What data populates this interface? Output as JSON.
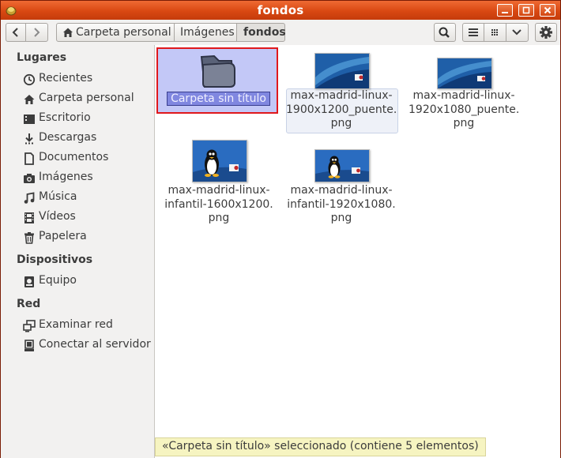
{
  "window": {
    "title": "fondos"
  },
  "path": {
    "items": [
      "Carpeta personal",
      "Imágenes",
      "fondos"
    ]
  },
  "sidebar": {
    "sections": [
      {
        "title": "Lugares",
        "items": [
          {
            "label": "Recientes",
            "icon": "clock-icon"
          },
          {
            "label": "Carpeta personal",
            "icon": "home-icon"
          },
          {
            "label": "Escritorio",
            "icon": "desktop-icon"
          },
          {
            "label": "Descargas",
            "icon": "download-icon"
          },
          {
            "label": "Documentos",
            "icon": "document-icon"
          },
          {
            "label": "Imágenes",
            "icon": "camera-icon"
          },
          {
            "label": "Música",
            "icon": "music-icon"
          },
          {
            "label": "Vídeos",
            "icon": "film-icon"
          },
          {
            "label": "Papelera",
            "icon": "trash-icon"
          }
        ]
      },
      {
        "title": "Dispositivos",
        "items": [
          {
            "label": "Equipo",
            "icon": "computer-icon"
          }
        ]
      },
      {
        "title": "Red",
        "items": [
          {
            "label": "Examinar red",
            "icon": "network-icon"
          },
          {
            "label": "Conectar al servidor",
            "icon": "server-icon"
          }
        ]
      }
    ]
  },
  "files": [
    {
      "name": "Carpeta sin título",
      "type": "folder",
      "state": "renaming"
    },
    {
      "name": [
        "max-madrid-linux-",
        "1900x1200_puente.",
        "png"
      ],
      "type": "image",
      "variant": "wave"
    },
    {
      "name": [
        "max-madrid-linux-",
        "1920x1080_puente.",
        "png"
      ],
      "type": "image",
      "variant": "wave"
    },
    {
      "name": [
        "max-madrid-linux-",
        "infantil-1600x1200.",
        "png"
      ],
      "type": "image",
      "variant": "penguin"
    },
    {
      "name": [
        "max-madrid-linux-",
        "infantil-1920x1080.",
        "png"
      ],
      "type": "image",
      "variant": "penguin"
    }
  ],
  "status": {
    "text": "«Carpeta sin título» seleccionado  (contiene 5 elementos)"
  },
  "colors": {
    "titlebar": "#d94812",
    "selection": "#c3c8f7",
    "highlight_border": "#e0181c"
  }
}
